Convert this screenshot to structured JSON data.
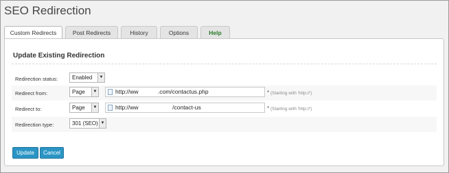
{
  "page": {
    "title": "SEO Redirection"
  },
  "tabs": [
    {
      "label": "Custom Redirects"
    },
    {
      "label": "Post Redirects"
    },
    {
      "label": "History"
    },
    {
      "label": "Options"
    },
    {
      "label": "Help"
    }
  ],
  "form": {
    "title": "Update Existing Redirection",
    "status": {
      "label": "Redirection status:",
      "value": "Enabled"
    },
    "from": {
      "label": "Redirect from:",
      "type": "Page",
      "url": "http://ww            .com/contactus.php",
      "hint_star": "*",
      "hint": "(Starting with 'http://')"
    },
    "to": {
      "label": "Redirect to:",
      "type": "Page",
      "url": "http://ww                     /contact-us",
      "hint_star": "*",
      "hint": "(Starting with 'http://')"
    },
    "redirect_type": {
      "label": "Redirection type:",
      "value": "301 (SEO)"
    }
  },
  "buttons": {
    "update": "Update",
    "cancel": "Cancel"
  },
  "icons": {
    "caret": "▼"
  }
}
